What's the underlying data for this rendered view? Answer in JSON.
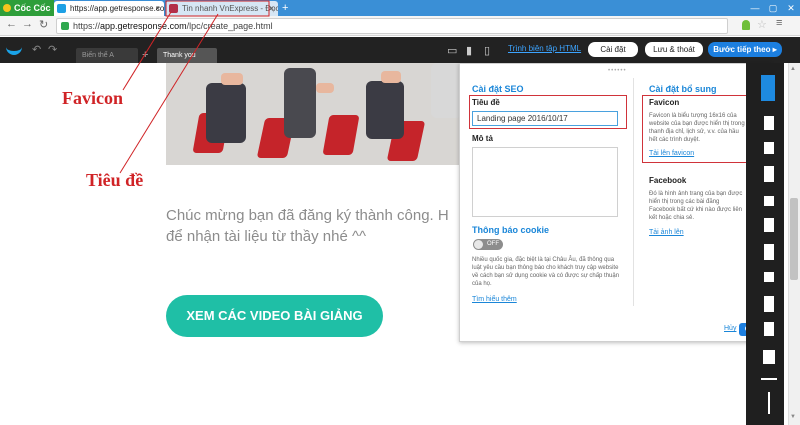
{
  "browser": {
    "brand": "Cốc Cốc",
    "tabs": [
      {
        "title": "https://app.getresponse.com",
        "close": "×"
      },
      {
        "title": "Tin nhanh VnExpress - Đọc",
        "close": "×"
      }
    ],
    "new_tab": "+",
    "url_scheme": "https://",
    "url_host": "app.getresponse.com",
    "url_path": "/lpc/create_page.html"
  },
  "editor": {
    "variant_a": "Biến thể A",
    "variant_add": "+",
    "variant_current": "Thank you page",
    "html_link": "Trình biên tập HTML",
    "settings_btn": "Cài đặt",
    "save_btn": "Lưu & thoát",
    "next_btn": "Bước tiếp theo ▸"
  },
  "page": {
    "hero_line1": "Chúc mừng bạn đã đăng ký thành công. H",
    "hero_line2": "để nhận tài liệu từ thầy nhé ^^",
    "cta": "XEM CÁC VIDEO BÀI GIẢNG"
  },
  "annotations": {
    "favicon": "Favicon",
    "title": "Tiêu đề",
    "color": "#d02326"
  },
  "dialog": {
    "seo_heading": "Cài đặt SEO",
    "title_label": "Tiêu đề",
    "title_value": "Landing page 2016/10/17",
    "desc_label": "Mô tả",
    "cookie_heading": "Thông báo cookie",
    "cookie_toggle": "OFF",
    "cookie_text": "Nhiều quốc gia, đặc biệt là tại Châu Âu, đã thông qua luật yêu cầu bạn thông báo cho khách truy cập website về cách bạn sử dụng cookie và có được sự chấp thuận của họ.",
    "learn_more": "Tìm hiểu thêm",
    "extra_heading": "Cài đặt bổ sung",
    "favicon_label": "Favicon",
    "favicon_text": "Favicon là biểu tượng 16x16 của website của bạn được hiển thị trong thanh địa chỉ, lịch sử, v.v. của hầu hết các trình duyệt.",
    "favicon_upload": "Tải lên favicon",
    "facebook_label": "Facebook",
    "facebook_text": "Đó là hình ảnh trang của bạn được hiển thị trong các bài đăng Facebook bất cứ khi nào được liên kết hoặc chia sẻ.",
    "image_upload": "Tải ảnh lên",
    "cancel": "Hủy",
    "ok": "OK"
  },
  "colors": {
    "accent": "#1c7fe0",
    "cta": "#1fbfa6",
    "toolbar": "#222222"
  }
}
